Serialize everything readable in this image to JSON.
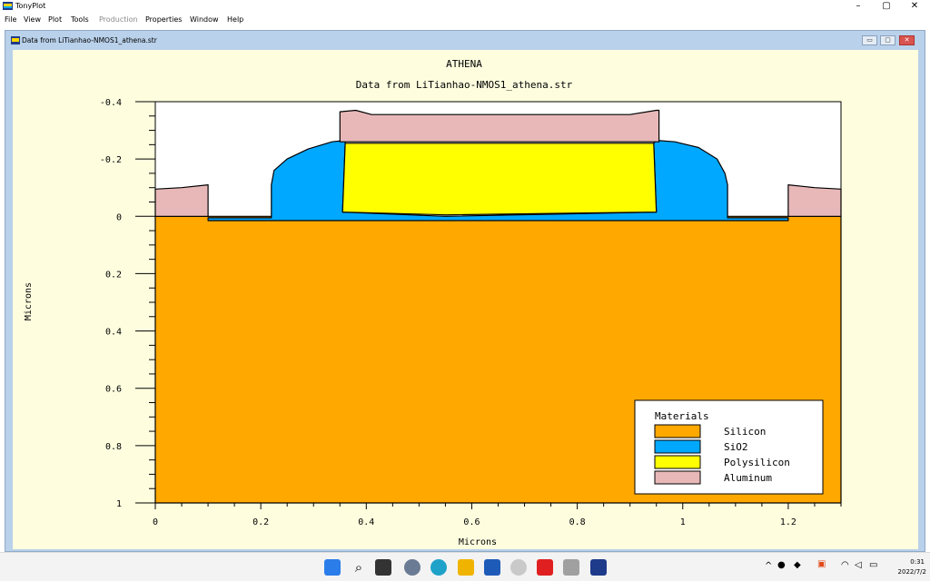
{
  "app": {
    "title": "TonyPlot",
    "controls": [
      "–",
      "▢",
      "✕"
    ]
  },
  "menu": {
    "items": [
      {
        "label": "File",
        "enabled": true
      },
      {
        "label": "View",
        "enabled": true
      },
      {
        "label": "Plot",
        "enabled": true
      },
      {
        "label": "Tools",
        "enabled": true
      },
      {
        "label": "Production",
        "enabled": false
      },
      {
        "label": "Properties",
        "enabled": true
      },
      {
        "label": "Window",
        "enabled": true
      },
      {
        "label": "Help",
        "enabled": true
      }
    ]
  },
  "child_window": {
    "title": "Data from LiTianhao-NMOS1_athena.str"
  },
  "chart_data": {
    "type": "cross-section",
    "title": "ATHENA",
    "subtitle": "Data from LiTianhao-NMOS1_athena.str",
    "xlabel": "Microns",
    "ylabel": "Microns",
    "xlim": [
      0,
      1.3
    ],
    "ylim": [
      -0.4,
      1
    ],
    "y_inverted": true,
    "x_ticks": [
      "0",
      "0.2",
      "0.4",
      "0.6",
      "0.8",
      "1",
      "1.2"
    ],
    "x_tick_values": [
      0,
      0.2,
      0.4,
      0.6,
      0.8,
      1,
      1.2
    ],
    "y_ticks": [
      "-0.4",
      "-0.2",
      "0",
      "0.2",
      "0.4",
      "0.6",
      "0.8",
      "1"
    ],
    "y_tick_values": [
      -0.4,
      -0.2,
      0,
      0.2,
      0.4,
      0.6,
      0.8,
      1
    ],
    "legend": {
      "title": "Materials",
      "position": "bottom-right",
      "entries": [
        {
          "name": "Silicon",
          "color": "#ffa800"
        },
        {
          "name": "SiO2",
          "color": "#00a8ff"
        },
        {
          "name": "Polysilicon",
          "color": "#ffff00"
        },
        {
          "name": "Aluminum",
          "color": "#e8b8b8"
        }
      ]
    },
    "regions": [
      {
        "material": "Silicon",
        "points": [
          [
            0,
            0
          ],
          [
            1.3,
            0
          ],
          [
            1.3,
            1
          ],
          [
            0,
            1
          ]
        ]
      },
      {
        "material": "SiO2",
        "points": [
          [
            0.1,
            0.015
          ],
          [
            0.1,
            0.005
          ],
          [
            0.22,
            0.005
          ],
          [
            0.22,
            -0.11
          ],
          [
            0.225,
            -0.16
          ],
          [
            0.25,
            -0.2
          ],
          [
            0.29,
            -0.235
          ],
          [
            0.335,
            -0.26
          ],
          [
            0.36,
            -0.265
          ],
          [
            0.36,
            -0.255
          ],
          [
            0.355,
            -0.015
          ],
          [
            0.55,
            0.0
          ],
          [
            0.95,
            -0.015
          ],
          [
            0.945,
            -0.255
          ],
          [
            0.95,
            -0.265
          ],
          [
            0.985,
            -0.26
          ],
          [
            1.03,
            -0.24
          ],
          [
            1.065,
            -0.2
          ],
          [
            1.08,
            -0.15
          ],
          [
            1.085,
            -0.11
          ],
          [
            1.085,
            0.005
          ],
          [
            1.2,
            0.005
          ],
          [
            1.2,
            0.015
          ]
        ]
      },
      {
        "material": "Polysilicon",
        "points": [
          [
            0.355,
            -0.015
          ],
          [
            0.36,
            -0.255
          ],
          [
            0.945,
            -0.255
          ],
          [
            0.95,
            -0.015
          ],
          [
            0.55,
            -0.005
          ]
        ]
      },
      {
        "material": "Aluminum",
        "points": [
          [
            0.35,
            -0.26
          ],
          [
            0.35,
            -0.365
          ],
          [
            0.38,
            -0.37
          ],
          [
            0.41,
            -0.355
          ],
          [
            0.9,
            -0.355
          ],
          [
            0.95,
            -0.37
          ],
          [
            0.955,
            -0.37
          ],
          [
            0.955,
            -0.26
          ]
        ]
      },
      {
        "material": "Aluminum",
        "points": [
          [
            0,
            0
          ],
          [
            0,
            -0.095
          ],
          [
            0.05,
            -0.1
          ],
          [
            0.1,
            -0.11
          ],
          [
            0.1,
            0
          ]
        ]
      },
      {
        "material": "Aluminum",
        "points": [
          [
            1.2,
            0
          ],
          [
            1.2,
            -0.11
          ],
          [
            1.25,
            -0.1
          ],
          [
            1.3,
            -0.095
          ],
          [
            1.3,
            0
          ]
        ]
      }
    ]
  },
  "taskbar": {
    "time": "0:31",
    "date": "2022/7/2"
  }
}
